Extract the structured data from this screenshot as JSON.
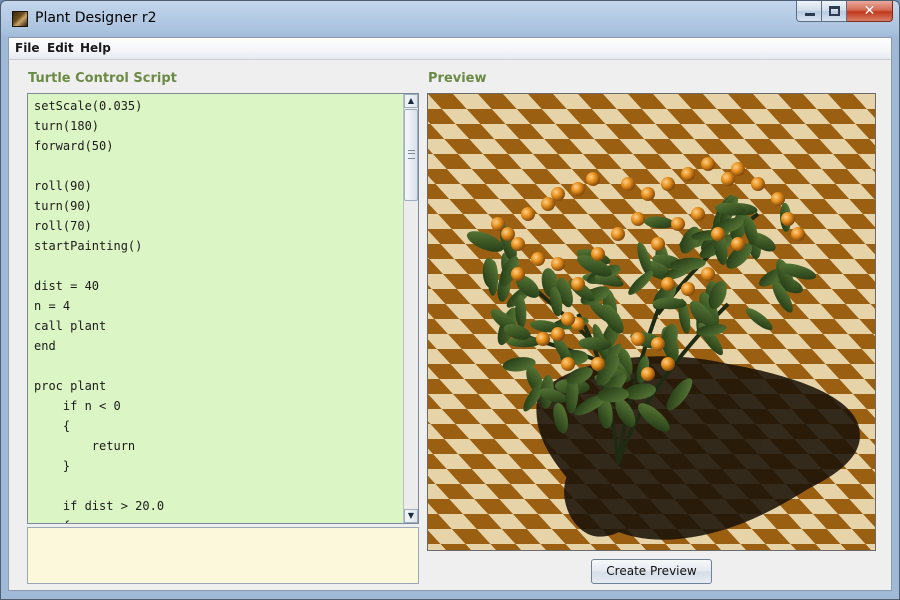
{
  "window": {
    "title": "Plant Designer r2",
    "icon": "plant-app-icon",
    "controls": {
      "minimize_icon": "minimize-icon",
      "maximize_icon": "maximize-icon",
      "close_icon": "close-icon",
      "close_glyph": "✕"
    }
  },
  "menu": {
    "items": [
      {
        "label": "File"
      },
      {
        "label": "Edit"
      },
      {
        "label": "Help"
      }
    ]
  },
  "script_panel": {
    "title": "Turtle Control Script",
    "lines": [
      "setScale(0.035)",
      "turn(180)",
      "forward(50)",
      "",
      "roll(90)",
      "turn(90)",
      "roll(70)",
      "startPainting()",
      "",
      "dist = 40",
      "n = 4",
      "call plant",
      "end",
      "",
      "proc plant",
      "    if n < 0",
      "    {",
      "        return",
      "    }",
      "",
      "    if dist > 20.0",
      "    {"
    ]
  },
  "message_area": {
    "text": ""
  },
  "preview_panel": {
    "title": "Preview",
    "image": "3D rendered plant on checkerboard floor",
    "colors": {
      "dark_tile": "#9b5f12",
      "light_tile": "#e6d4a8",
      "leaf": "#2c4a1c",
      "fruit": "#e08a1e",
      "shadow": "#1a1208"
    }
  },
  "actions": {
    "create_preview_label": "Create Preview"
  },
  "colors": {
    "section_label": "#6b8a44",
    "editor_background": "#dcf5c5",
    "message_background": "#fbf8dc"
  }
}
